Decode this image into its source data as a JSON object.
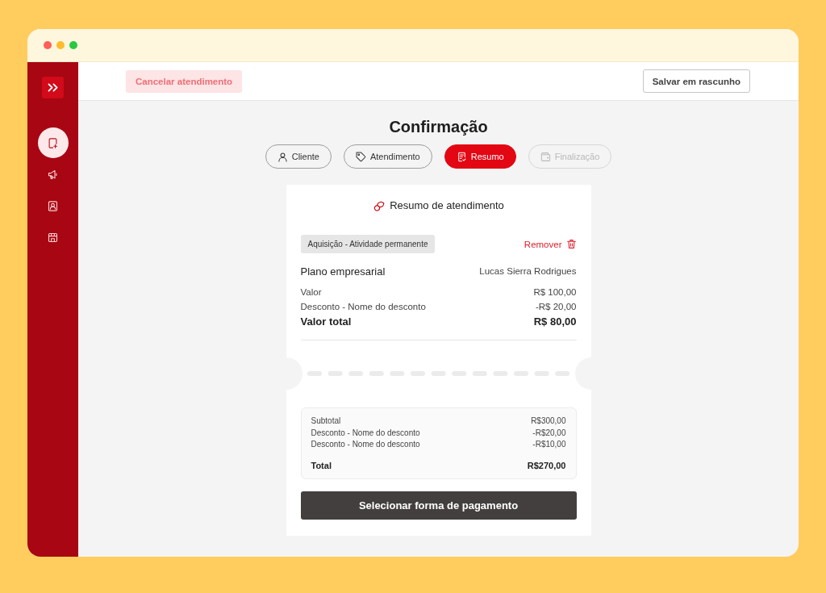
{
  "sidebar": {
    "nav_items": [
      {
        "selected": true
      },
      {
        "selected": false
      },
      {
        "selected": false
      },
      {
        "selected": false
      }
    ]
  },
  "top_bar": {
    "cancel_button": "Cancelar atendimento",
    "save_button": "Salvar em rascunho"
  },
  "title": "Confirmação",
  "steps": [
    {
      "label": "Cliente",
      "selected": false,
      "disabled": false
    },
    {
      "label": "Atendimento",
      "selected": false,
      "disabled": false
    },
    {
      "label": "Resumo",
      "selected": true,
      "disabled": false
    },
    {
      "label": "Finalização",
      "selected": false,
      "disabled": true
    }
  ],
  "summary_card": {
    "title": "Resumo de atendimento",
    "item": {
      "tag": "Aquisição - Atividade permanente",
      "remove_button": "Remover",
      "plan": "Plano empresarial",
      "client": "Lucas Sierra Rodrigues",
      "lines": [
        {
          "label": "Valor",
          "value": "R$ 100,00"
        },
        {
          "label": "Desconto - Nome do desconto",
          "value": "-R$ 20,00"
        }
      ],
      "total": {
        "label": "Valor total",
        "value": "R$ 80,00"
      }
    },
    "totals": {
      "lines": [
        {
          "label": "Subtotal",
          "value": "R$300,00"
        },
        {
          "label": "Desconto - Nome do desconto",
          "value": "-R$20,00"
        },
        {
          "label": "Desconto - Nome do desconto",
          "value": "-R$10,00"
        }
      ],
      "total": {
        "label": "Total",
        "value": "R$270,00"
      }
    },
    "pay_button": "Selecionar forma de pagamento"
  }
}
